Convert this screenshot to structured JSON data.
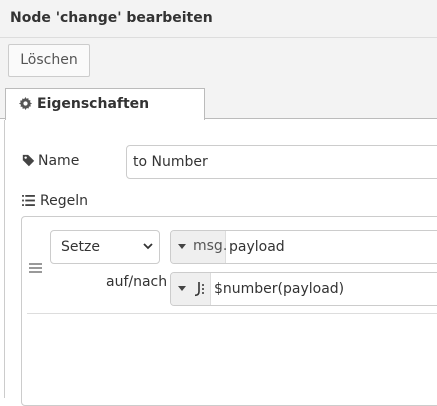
{
  "header": {
    "title": "Node 'change' bearbeiten"
  },
  "toolbar": {
    "delete_label": "Löschen"
  },
  "tabs": [
    {
      "label": "Eigenschaften",
      "icon": "gear-icon"
    }
  ],
  "form": {
    "name": {
      "label": "Name",
      "icon": "tag-icon",
      "value": "to Number"
    },
    "rules": {
      "label": "Regeln",
      "icon": "list-icon",
      "items": [
        {
          "action": "Setze",
          "property_type": "msg.",
          "property": "payload",
          "to_label": "auf/nach",
          "value_type_icon": "jsonata-icon",
          "value": "$number(payload)"
        }
      ]
    }
  },
  "colors": {
    "header_bg": "#f3f3f3",
    "border": "#cccccc",
    "type_button_bg": "#efefef"
  }
}
